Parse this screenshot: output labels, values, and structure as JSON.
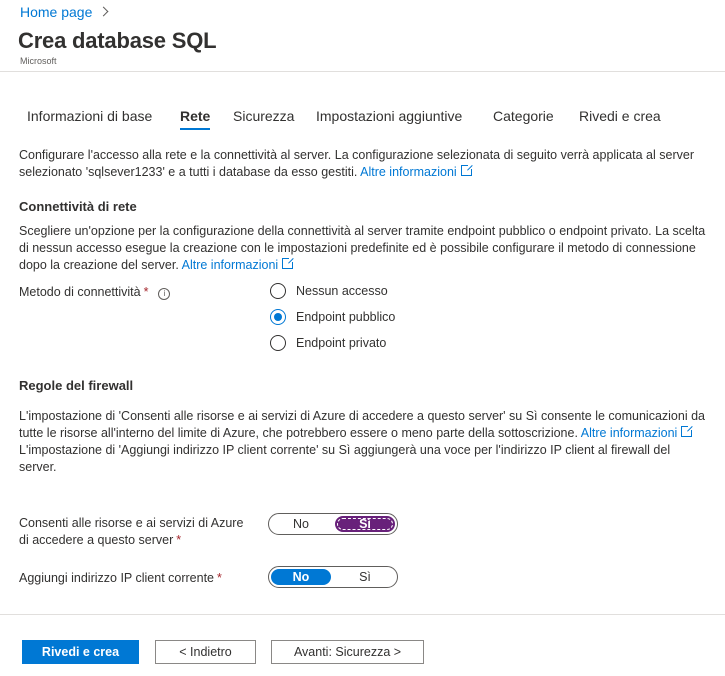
{
  "breadcrumb": {
    "home": "Home page"
  },
  "header": {
    "title": "Crea database SQL",
    "publisher": "Microsoft"
  },
  "tabs": [
    {
      "label": "Informazioni di base"
    },
    {
      "label": "Rete"
    },
    {
      "label": "Sicurezza"
    },
    {
      "label": "Impostazioni aggiuntive"
    },
    {
      "label": "Categorie"
    },
    {
      "label": "Rivedi e crea"
    }
  ],
  "active_tab": "Rete",
  "intro": {
    "text": "Configurare l'accesso alla rete e la connettività al server. La configurazione selezionata di seguito verrà applicata al server selezionato 'sqlsever1233' e a tutti i database da esso gestiti.",
    "link": "Altre informazioni"
  },
  "connectivity": {
    "heading": "Connettività di rete",
    "text": "Scegliere un'opzione per la configurazione della connettività al server tramite endpoint pubblico o endpoint privato. La scelta di nessun accesso esegue la creazione con le impostazioni predefinite ed è possibile configurare il metodo di connessione dopo la creazione del server.",
    "link": "Altre informazioni",
    "method_label": "Metodo di connettività",
    "required_mark": "*",
    "info_glyph": "i",
    "options": [
      {
        "label": "Nessun accesso",
        "selected": false
      },
      {
        "label": "Endpoint pubblico",
        "selected": true
      },
      {
        "label": "Endpoint privato",
        "selected": false
      }
    ]
  },
  "firewall": {
    "heading": "Regole del firewall",
    "text1": "L'impostazione di 'Consenti alle risorse e ai servizi di Azure di accedere a questo server' su Sì consente le comunicazioni da tutte le risorse all'interno del limite di Azure, che potrebbero essere o meno parte della sottoscrizione.",
    "link1_a": "Altre",
    "link1_b": "informazioni",
    "text2": "L'impostazione di 'Aggiungi indirizzo IP client corrente' su Sì aggiungerà una voce per l'indirizzo IP client al firewall del server.",
    "allow_azure": {
      "label_line1": "Consenti alle risorse e ai servizi di Azure",
      "label_line2": "di accedere a questo server",
      "required_mark": "*",
      "no": "No",
      "yes": "Sì",
      "value": "Sì"
    },
    "add_client_ip": {
      "label": "Aggiungi indirizzo IP client corrente",
      "required_mark": "*",
      "no": "No",
      "yes": "Sì",
      "value": "No"
    }
  },
  "footer": {
    "review_create": "Rivedi e crea",
    "back": "< Indietro",
    "next": "Avanti: Sicurezza >"
  },
  "colors": {
    "accent": "#0078d4",
    "toggle_on_purple": "#68217a",
    "required": "#a4262c"
  }
}
